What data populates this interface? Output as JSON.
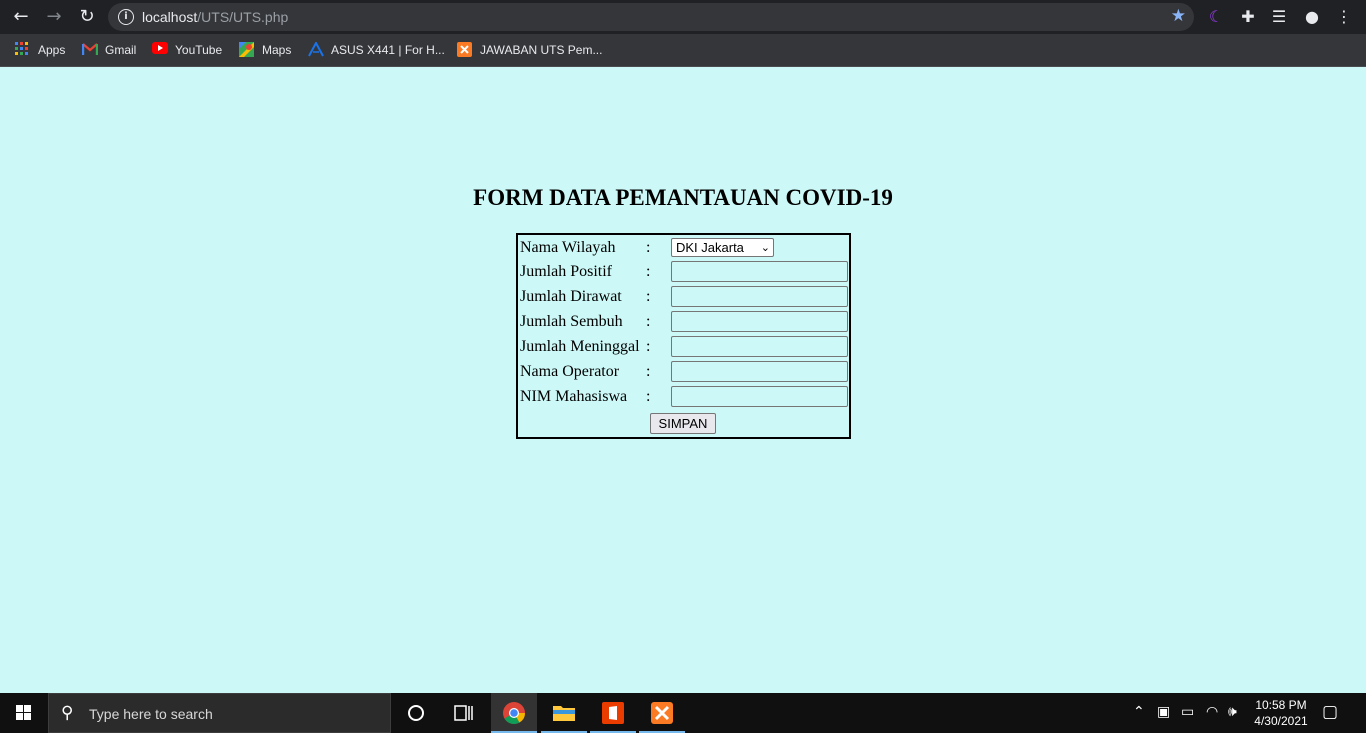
{
  "browser": {
    "url_host": "localhost",
    "url_path": "/UTS/UTS.php",
    "bookmarks": [
      {
        "label": "Apps",
        "icon": "apps-grid-icon"
      },
      {
        "label": "Gmail",
        "icon": "gmail-icon"
      },
      {
        "label": "YouTube",
        "icon": "youtube-icon"
      },
      {
        "label": "Maps",
        "icon": "maps-icon"
      },
      {
        "label": "ASUS X441 | For H...",
        "icon": "asus-icon"
      },
      {
        "label": "JAWABAN UTS Pem...",
        "icon": "xampp-icon"
      }
    ]
  },
  "page": {
    "title": "FORM DATA PEMANTAUAN COVID-19",
    "fields": [
      {
        "label": "Nama Wilayah",
        "type": "select",
        "value": "DKI Jakarta"
      },
      {
        "label": "Jumlah Positif",
        "type": "text",
        "value": ""
      },
      {
        "label": "Jumlah Dirawat",
        "type": "text",
        "value": ""
      },
      {
        "label": "Jumlah Sembuh",
        "type": "text",
        "value": ""
      },
      {
        "label": "Jumlah Meninggal",
        "type": "text",
        "value": ""
      },
      {
        "label": "Nama Operator",
        "type": "text",
        "value": ""
      },
      {
        "label": "NIM Mahasiswa",
        "type": "text",
        "value": ""
      }
    ],
    "colon": ":",
    "submit_label": "SIMPAN"
  },
  "taskbar": {
    "search_placeholder": "Type here to search",
    "time": "10:58 PM",
    "date": "4/30/2021"
  },
  "colors": {
    "page_bg": "#ccf9f7",
    "chrome_dark": "#202124",
    "taskbar": "#101010"
  }
}
